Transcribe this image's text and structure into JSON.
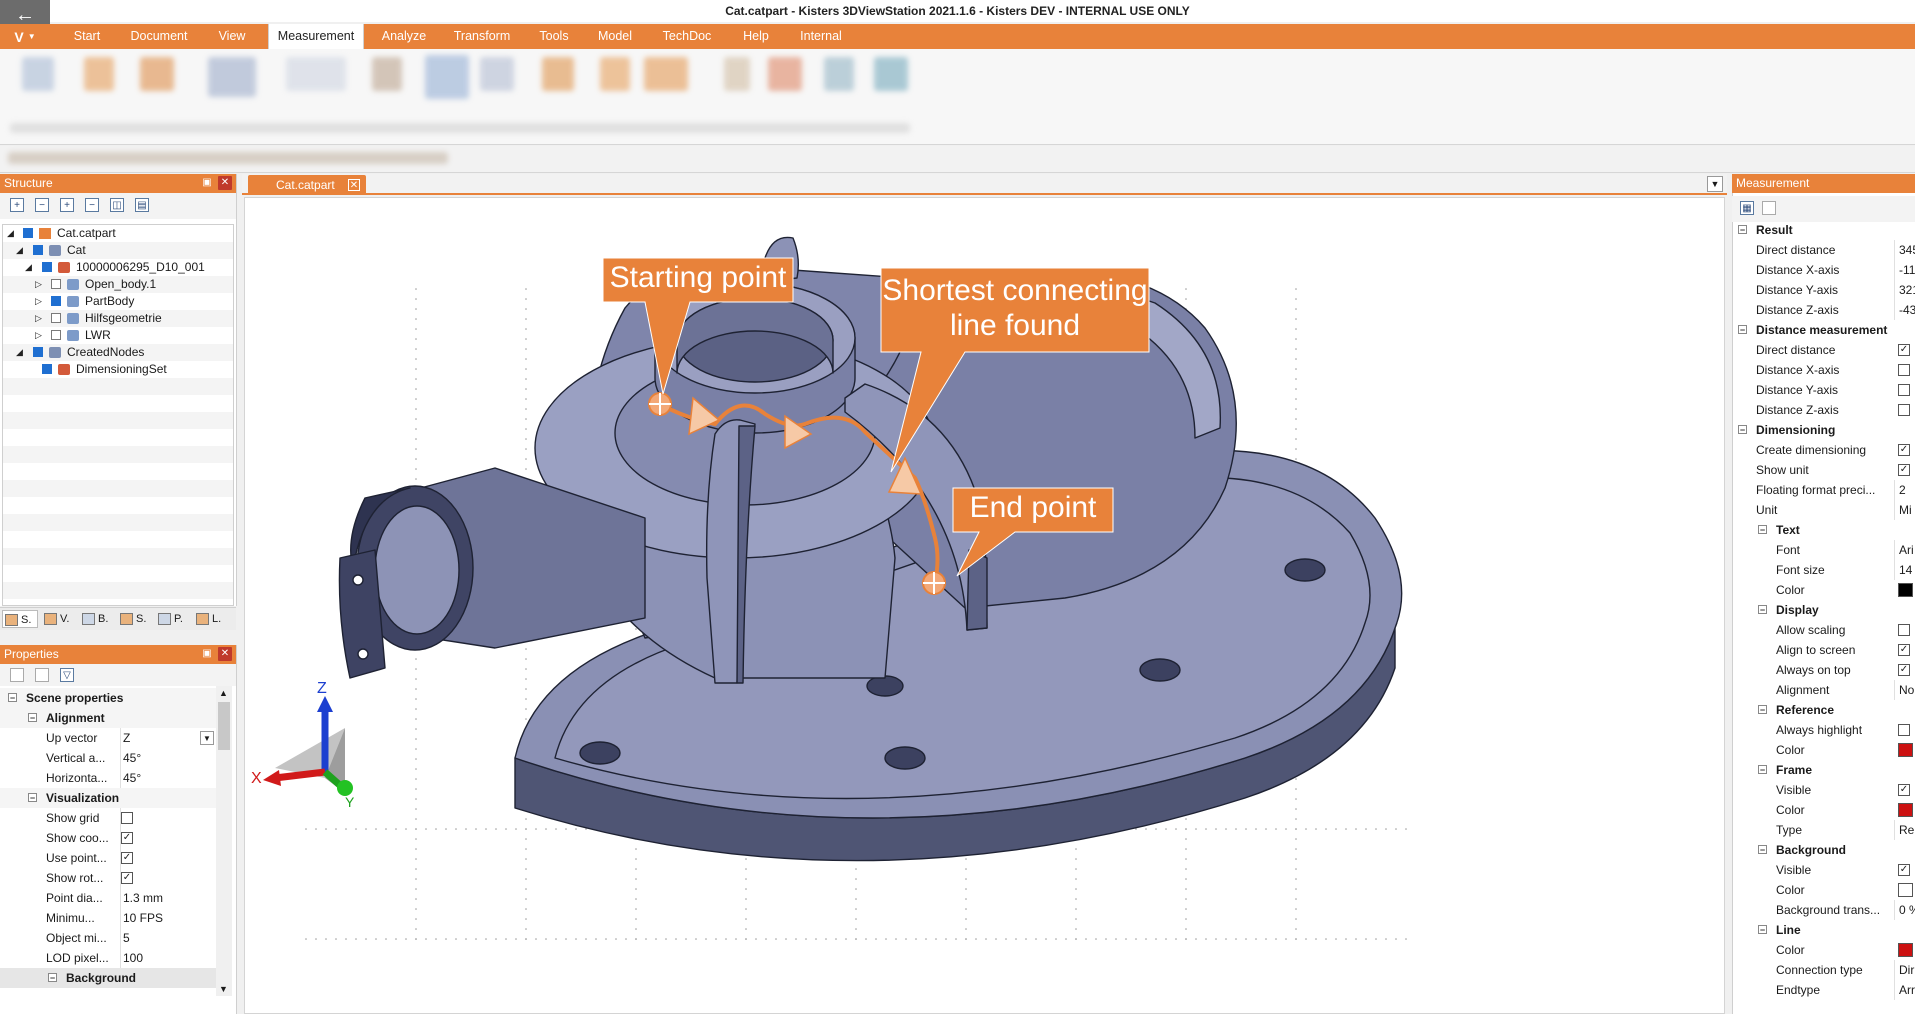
{
  "window": {
    "title": "Cat.catpart - Kisters 3DViewStation 2021.1.6 - Kisters DEV - INTERNAL USE ONLY",
    "app_logo": "V"
  },
  "ribbon": {
    "tabs": [
      "Start",
      "Document",
      "View",
      "Measurement",
      "Analyze",
      "Transform",
      "Tools",
      "Model",
      "TechDoc",
      "Help",
      "Internal"
    ],
    "active_tab": "Measurement"
  },
  "structure": {
    "title": "Structure",
    "tree": [
      {
        "label": "Cat.catpart",
        "checked": true
      },
      {
        "label": "Cat",
        "checked": true
      },
      {
        "label": "10000006295_D10_001",
        "checked": true
      },
      {
        "label": "Open_body.1",
        "checked": false
      },
      {
        "label": "PartBody",
        "checked": true
      },
      {
        "label": "Hilfsgeometrie",
        "checked": false
      },
      {
        "label": "LWR",
        "checked": false
      },
      {
        "label": "CreatedNodes",
        "checked": true
      },
      {
        "label": "DimensioningSet",
        "checked": true
      }
    ],
    "bottom_tabs": [
      "S.",
      "V.",
      "B.",
      "S.",
      "P.",
      "L."
    ]
  },
  "properties": {
    "title": "Properties",
    "scene_group": "Scene properties",
    "alignment_group": "Alignment",
    "up_vector": {
      "label": "Up vector",
      "value": "Z"
    },
    "vertical_angle": {
      "label": "Vertical a...",
      "value": "45°"
    },
    "horizontal_angle": {
      "label": "Horizonta...",
      "value": "45°"
    },
    "visualization_group": "Visualization",
    "show_grid": {
      "label": "Show grid",
      "checked": false
    },
    "show_coords": {
      "label": "Show coo...",
      "checked": true
    },
    "use_point": {
      "label": "Use point...",
      "checked": true
    },
    "show_rot": {
      "label": "Show rot...",
      "checked": true
    },
    "point_diameter": {
      "label": "Point dia...",
      "value": "1.3 mm"
    },
    "minimum_fps": {
      "label": "Minimu...",
      "value": "10 FPS"
    },
    "object_min": {
      "label": "Object mi...",
      "value": "5"
    },
    "lod_pixel": {
      "label": "LOD pixel...",
      "value": "100"
    },
    "background_group": "Background"
  },
  "document": {
    "tab_label": "Cat.catpart"
  },
  "callouts": {
    "start": "Starting point",
    "shortest_line1": "Shortest connecting",
    "shortest_line2": "line found",
    "end": "End point"
  },
  "axes": {
    "x": "X",
    "y": "Y",
    "z": "Z"
  },
  "measurement": {
    "title": "Measurement",
    "result_group": "Result",
    "direct_distance": {
      "label": "Direct distance",
      "value": "345"
    },
    "distance_x": {
      "label": "Distance X-axis",
      "value": "-11"
    },
    "distance_y": {
      "label": "Distance Y-axis",
      "value": "321"
    },
    "distance_z": {
      "label": "Distance Z-axis",
      "value": "-43"
    },
    "distance_measurement_group": "Distance measurement",
    "dm_direct": "Direct distance",
    "dm_x": "Distance X-axis",
    "dm_y": "Distance Y-axis",
    "dm_z": "Distance Z-axis",
    "dimensioning_group": "Dimensioning",
    "create_dimensioning": "Create dimensioning",
    "show_unit": "Show unit",
    "floating_format": {
      "label": "Floating format preci...",
      "value": "2"
    },
    "unit": {
      "label": "Unit",
      "value": "Mi"
    },
    "text_group": "Text",
    "font": {
      "label": "Font",
      "value": "Ari"
    },
    "font_size": {
      "label": "Font size",
      "value": "14"
    },
    "text_color": {
      "label": "Color",
      "color": "#000000"
    },
    "display_group": "Display",
    "allow_scaling": "Allow scaling",
    "align_to_screen": "Align to screen",
    "always_on_top": "Always on top",
    "alignment": {
      "label": "Alignment",
      "value": "No"
    },
    "reference_group": "Reference",
    "always_highlight": "Always highlight",
    "reference_color": {
      "label": "Color",
      "color": "#cc1111"
    },
    "frame_group": "Frame",
    "frame_visible": "Visible",
    "frame_color": {
      "label": "Color",
      "color": "#cc1111"
    },
    "frame_type": {
      "label": "Type",
      "value": "Re"
    },
    "background_group": "Background",
    "bg_visible": "Visible",
    "bg_color": {
      "label": "Color",
      "color": "#ffffff"
    },
    "bg_transparency": {
      "label": "Background trans...",
      "value": "0 %"
    },
    "line_group": "Line",
    "line_color": {
      "label": "Color",
      "color": "#cc1111"
    },
    "connection_type": {
      "label": "Connection type",
      "value": "Dir"
    },
    "endtype": {
      "label": "Endtype",
      "value": "Arr"
    }
  },
  "theme": {
    "accent": "#e8823a",
    "part_fill": "#7b82a6"
  }
}
